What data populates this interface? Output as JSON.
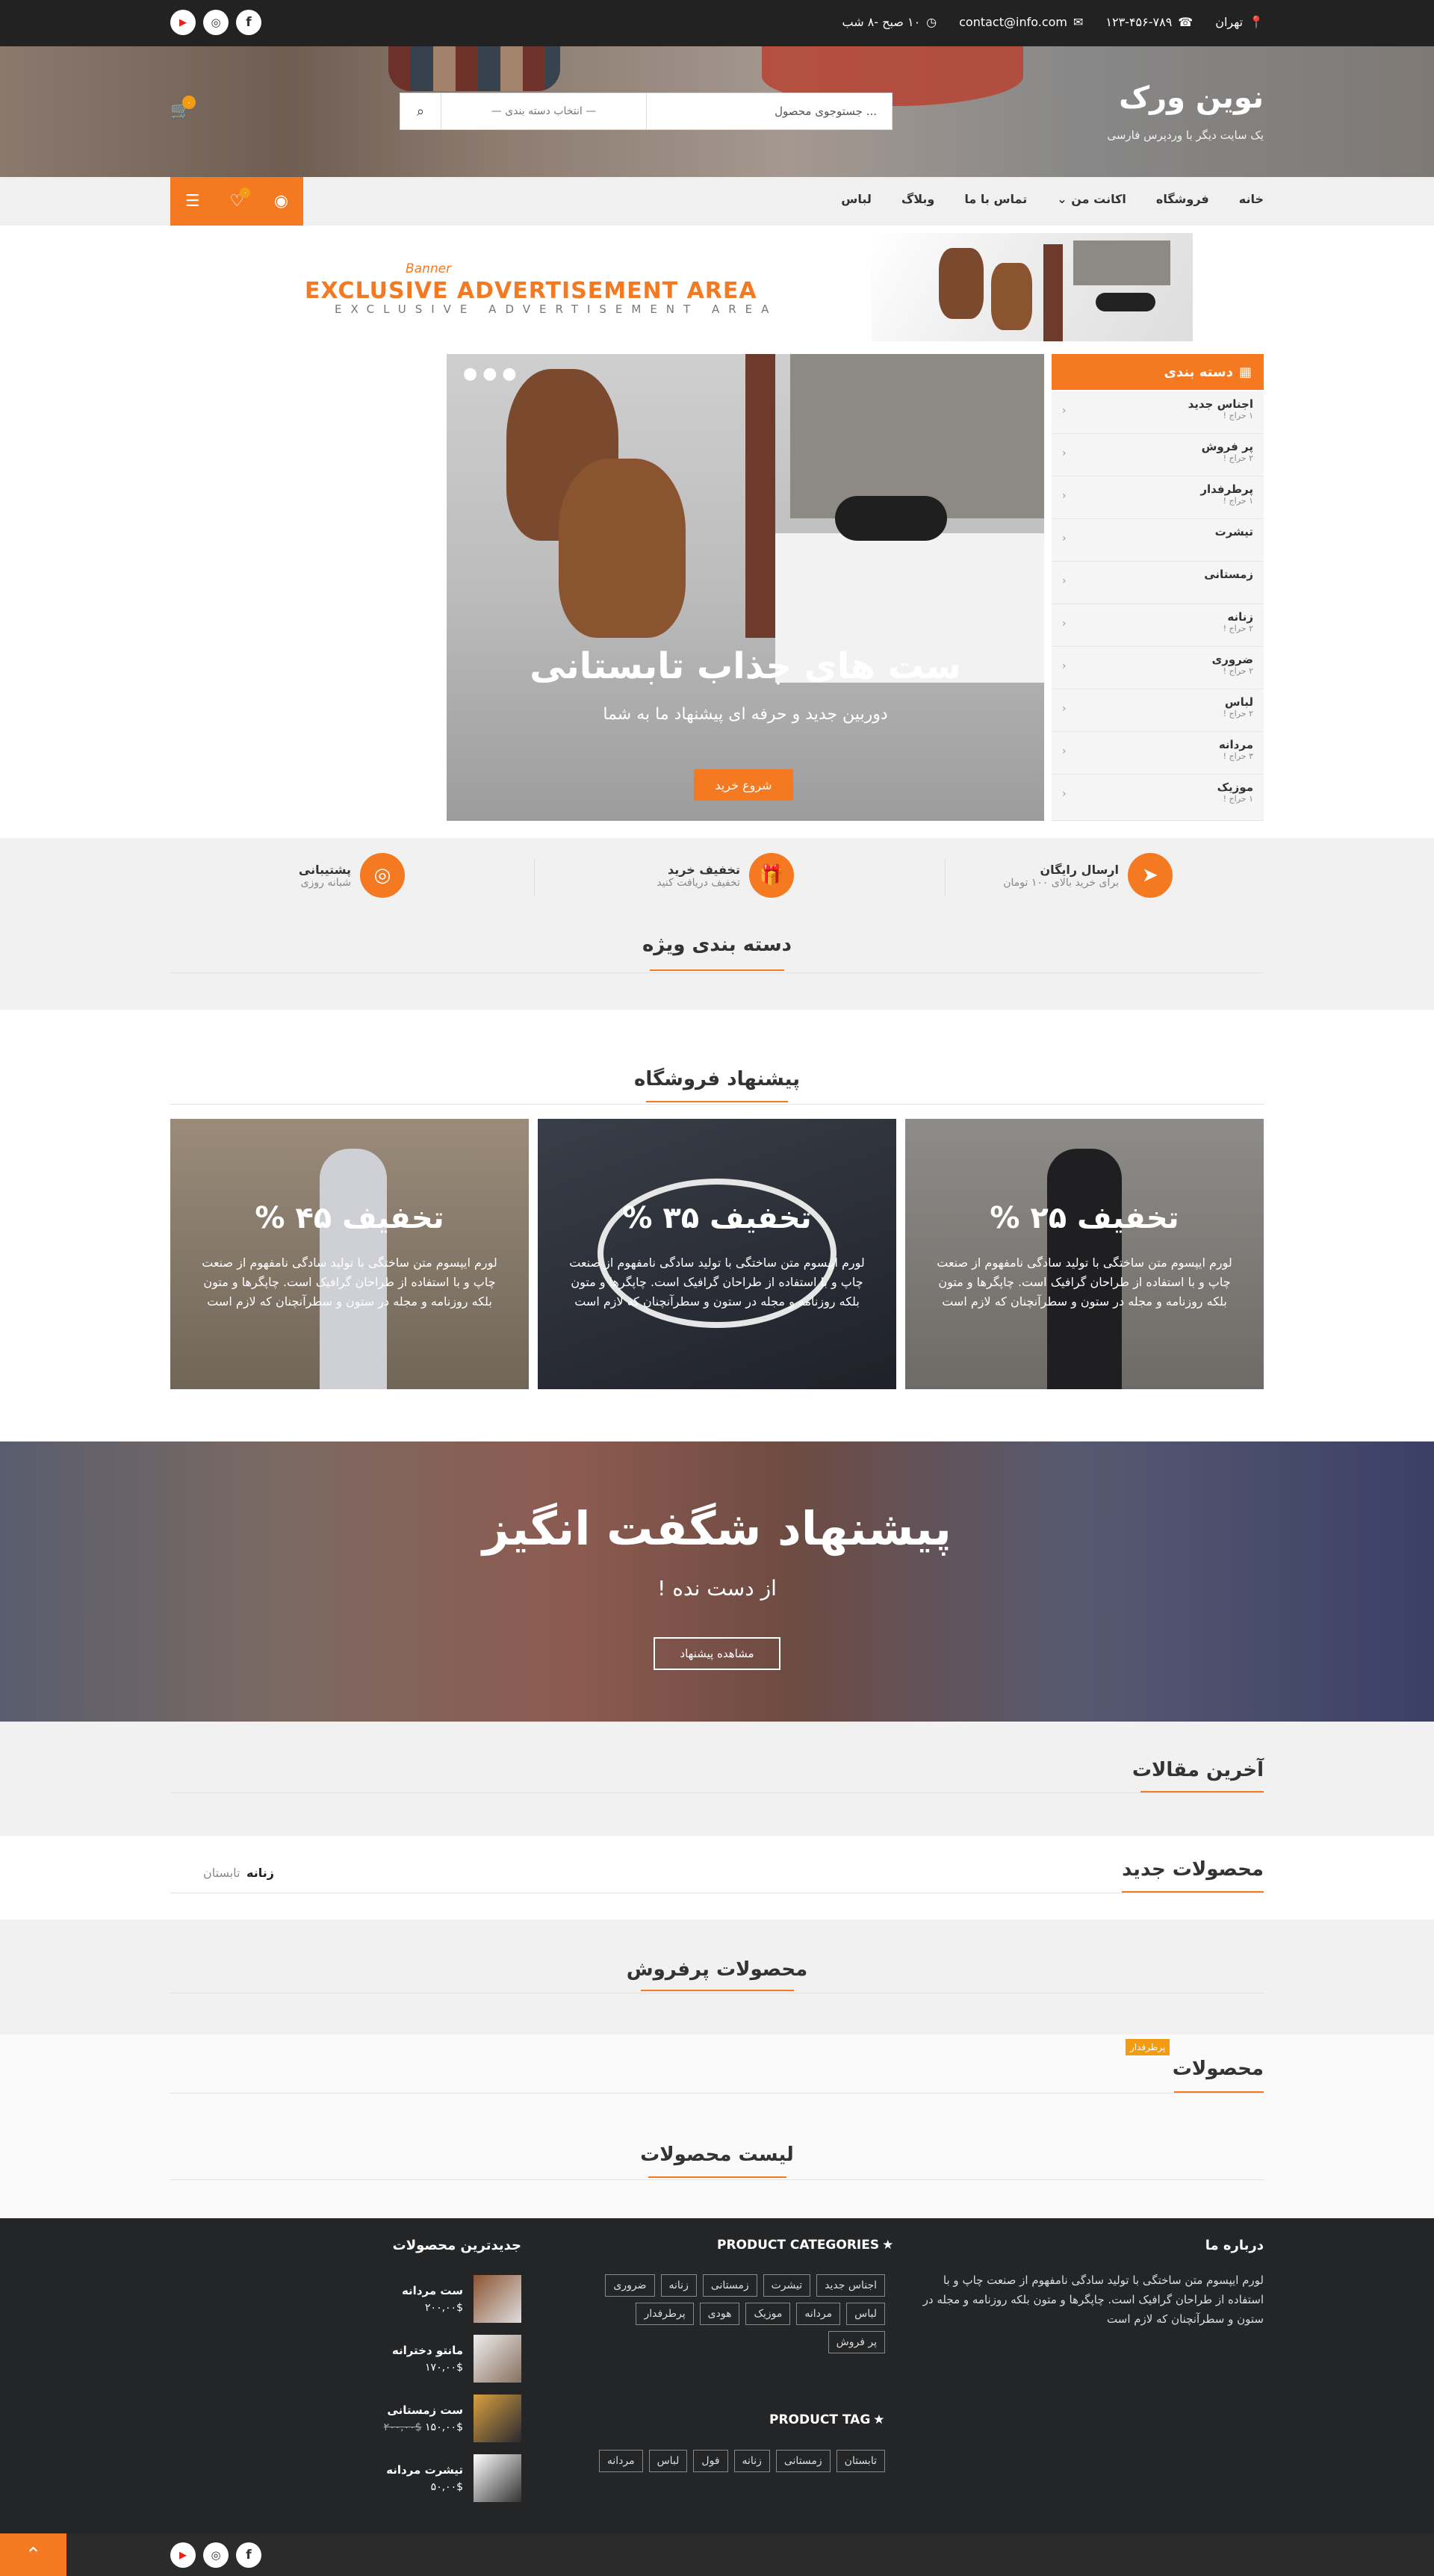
{
  "topbar": {
    "city": "تهران",
    "phone": "۱۲۳-۴۵۶-۷۸۹",
    "email": "contact@info.com",
    "hours": "۱۰ صبح -۸ شب"
  },
  "header": {
    "brand_title": "نوین ورک",
    "brand_subtitle": "یک سایت دیگر با وردپرس فارسی",
    "search_placeholder": "جستوجوی محصول ...",
    "category_select": "— انتخاب دسته بندی —",
    "cart_count": "۰",
    "wishlist_count": "۰"
  },
  "nav": {
    "items": [
      "خانه",
      "فروشگاه",
      "اکانت من",
      "تماس با ما",
      "وبلاگ",
      "لباس"
    ]
  },
  "advert": {
    "main": "EXCLUSIVE ADVERTISEMENT AREA",
    "sub": "EXCLUSIVE ADVERTISEMENT AREA",
    "script": "Banner"
  },
  "categories": {
    "title": "دسته بندی",
    "items": [
      {
        "name": "اجناس جدید",
        "count": "۱ حراج !"
      },
      {
        "name": "پر فروش",
        "count": "۲ حراج !"
      },
      {
        "name": "پرطرفدار",
        "count": "۱ حراج !"
      },
      {
        "name": "تیشرت",
        "count": ""
      },
      {
        "name": "زمستانی",
        "count": ""
      },
      {
        "name": "زنانه",
        "count": "۲ حراج !"
      },
      {
        "name": "ضروری",
        "count": "۲ حراج !"
      },
      {
        "name": "لباس",
        "count": "۲ حراج !"
      },
      {
        "name": "مردانه",
        "count": "۳ حراج !"
      },
      {
        "name": "موزیک",
        "count": "۱ حراج !"
      }
    ]
  },
  "slider": {
    "title": "ست های جذاب تابستانی",
    "subtitle": "دوربین جدید و حرفه ای پیشنهاد ما به شما",
    "button": "شروع خرید"
  },
  "features": [
    {
      "title": "ارسال رایگان",
      "sub": "برای خرید بالای ۱۰۰ تومان"
    },
    {
      "title": "تخفیف خرید",
      "sub": "تخفیف دریافت کنید"
    },
    {
      "title": "پشتیبانی",
      "sub": "شبانه روزی"
    }
  ],
  "sections": {
    "special_categories": "دسته بندی ویژه",
    "store_offer": "پیشنهاد فروشگاه",
    "latest_articles": "آخرین مقالات",
    "new_products": "محصولات جدید",
    "tab_women": "زنانه",
    "tab_summer": "تابستان",
    "bestsellers": "محصولات پرفروش",
    "popular_badge": "پرطرفدار",
    "products": "محصولات",
    "product_list": "لیست محصولات"
  },
  "promos": [
    {
      "title": "تخفیف ۲۵ %",
      "desc": "لورم ایپسوم متن ساختگی با تولید سادگی نامفهوم از صنعت چاپ و با استفاده از طراحان گرافیک است. چاپگرها و متون بلکه روزنامه و مجله در ستون و سطرآنچنان که لازم است"
    },
    {
      "title": "تخفیف ۳۵ %",
      "desc": "لورم ایپسوم متن ساختگی با تولید سادگی نامفهوم از صنعت چاپ و با استفاده از طراحان گرافیک است. چاپگرها و متون بلکه روزنامه و مجله در ستون و سطرآنچنان که لازم است"
    },
    {
      "title": "تخفیف ۴۵ %",
      "desc": "لورم ایپسوم متن ساختگی با تولید سادگی نامفهوم از صنعت چاپ و با استفاده از طراحان گرافیک است. چاپگرها و متون بلکه روزنامه و مجله در ستون و سطرآنچنان که لازم است"
    }
  ],
  "offer": {
    "title": "پیشنهاد شگفت انگیز",
    "subtitle": "از دست نده !",
    "button": "مشاهده پیشنهاد"
  },
  "footer": {
    "about_title": "درباره ما",
    "about_text": "لورم ایپسوم متن ساختگی با تولید سادگی نامفهوم از صنعت چاپ و با استفاده از طراحان گرافیک است. چاپگرها و متون بلکه روزنامه و مجله در ستون و سطرآنچنان که لازم است",
    "cat_title": "PRODUCT CATEGORIES",
    "cat_tags": [
      "اجناس جدید",
      "تیشرت",
      "زمستانی",
      "زنانه",
      "ضروری",
      "لباس",
      "مردانه",
      "موزیک",
      "هودی",
      "پرطرفدار",
      "پر فروش"
    ],
    "tag_title": "PRODUCT TAG",
    "tags": [
      "تابستان",
      "زمستانی",
      "زنانه",
      "فول",
      "لباس",
      "مردانه"
    ],
    "latest_title": "جدیدترین محصولات",
    "latest": [
      {
        "name": "ست مردانه",
        "price": "۲۰۰,۰۰$",
        "old": ""
      },
      {
        "name": "مانتو دخترانه",
        "price": "۱۷۰,۰۰$",
        "old": ""
      },
      {
        "name": "ست زمستانی",
        "price": "۱۵۰,۰۰$",
        "old": "۲۰۰,۰۰$"
      },
      {
        "name": "تیشرت مردانه",
        "price": "۵۰,۰۰$",
        "old": ""
      }
    ]
  },
  "colors": {
    "accent": "#f47920",
    "dark": "#222222",
    "footer": "#232527"
  }
}
